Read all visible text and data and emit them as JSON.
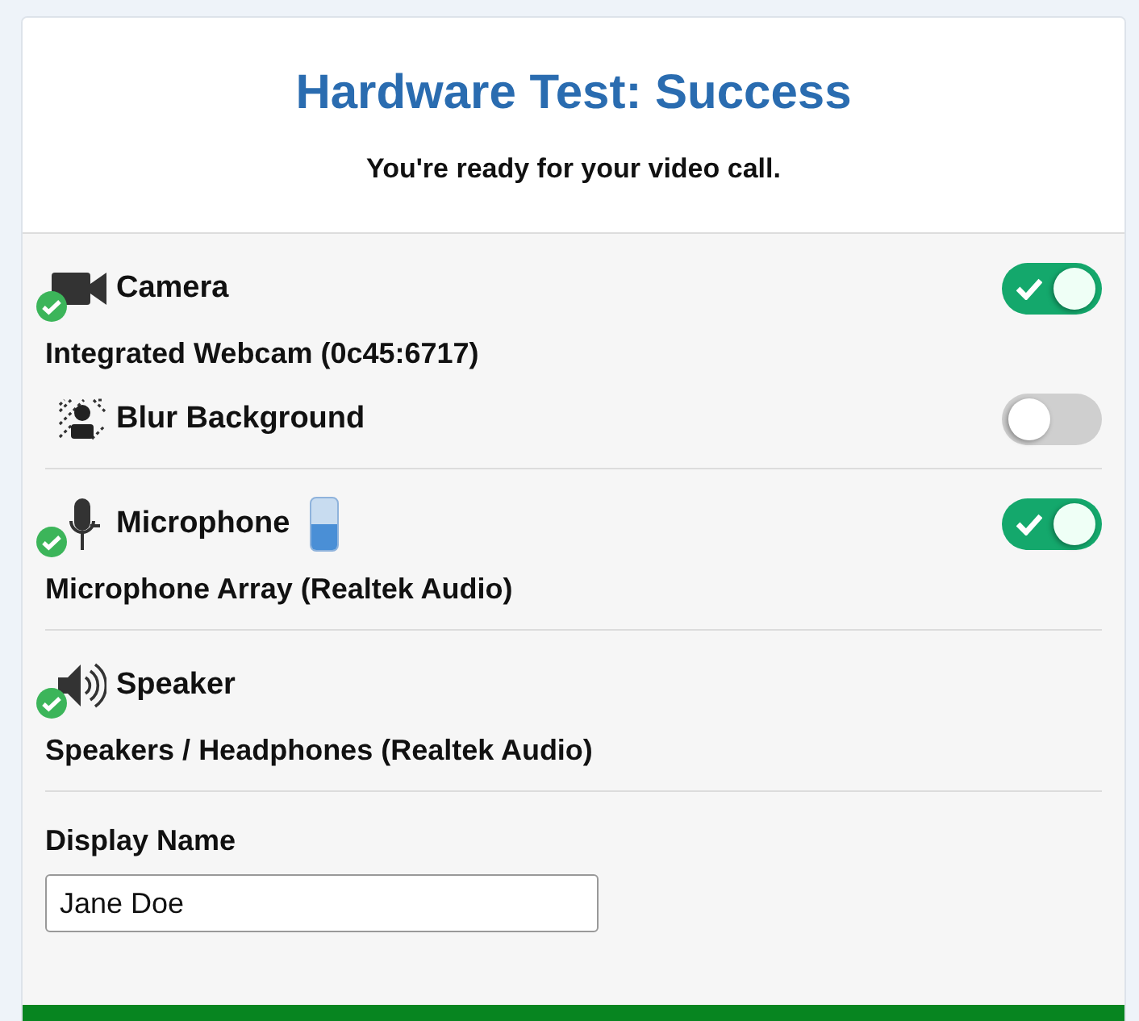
{
  "header": {
    "title": "Hardware Test: Success",
    "subtitle": "You're ready for your video call."
  },
  "devices": [
    {
      "kind": "camera",
      "label": "Camera",
      "status_ok": true,
      "on": true,
      "device": "Integrated Webcam (0c45:6717)",
      "options": [
        {
          "label": "Blur Background",
          "on": false
        }
      ]
    },
    {
      "kind": "microphone",
      "label": "Microphone",
      "status_ok": true,
      "on": true,
      "level": 0.5,
      "device": "Microphone Array (Realtek Audio)"
    },
    {
      "kind": "speaker",
      "label": "Speaker",
      "status_ok": true,
      "device": "Speakers / Headphones (Realtek Audio)"
    }
  ],
  "display_name": {
    "label": "Display Name",
    "value": "Jane Doe"
  }
}
